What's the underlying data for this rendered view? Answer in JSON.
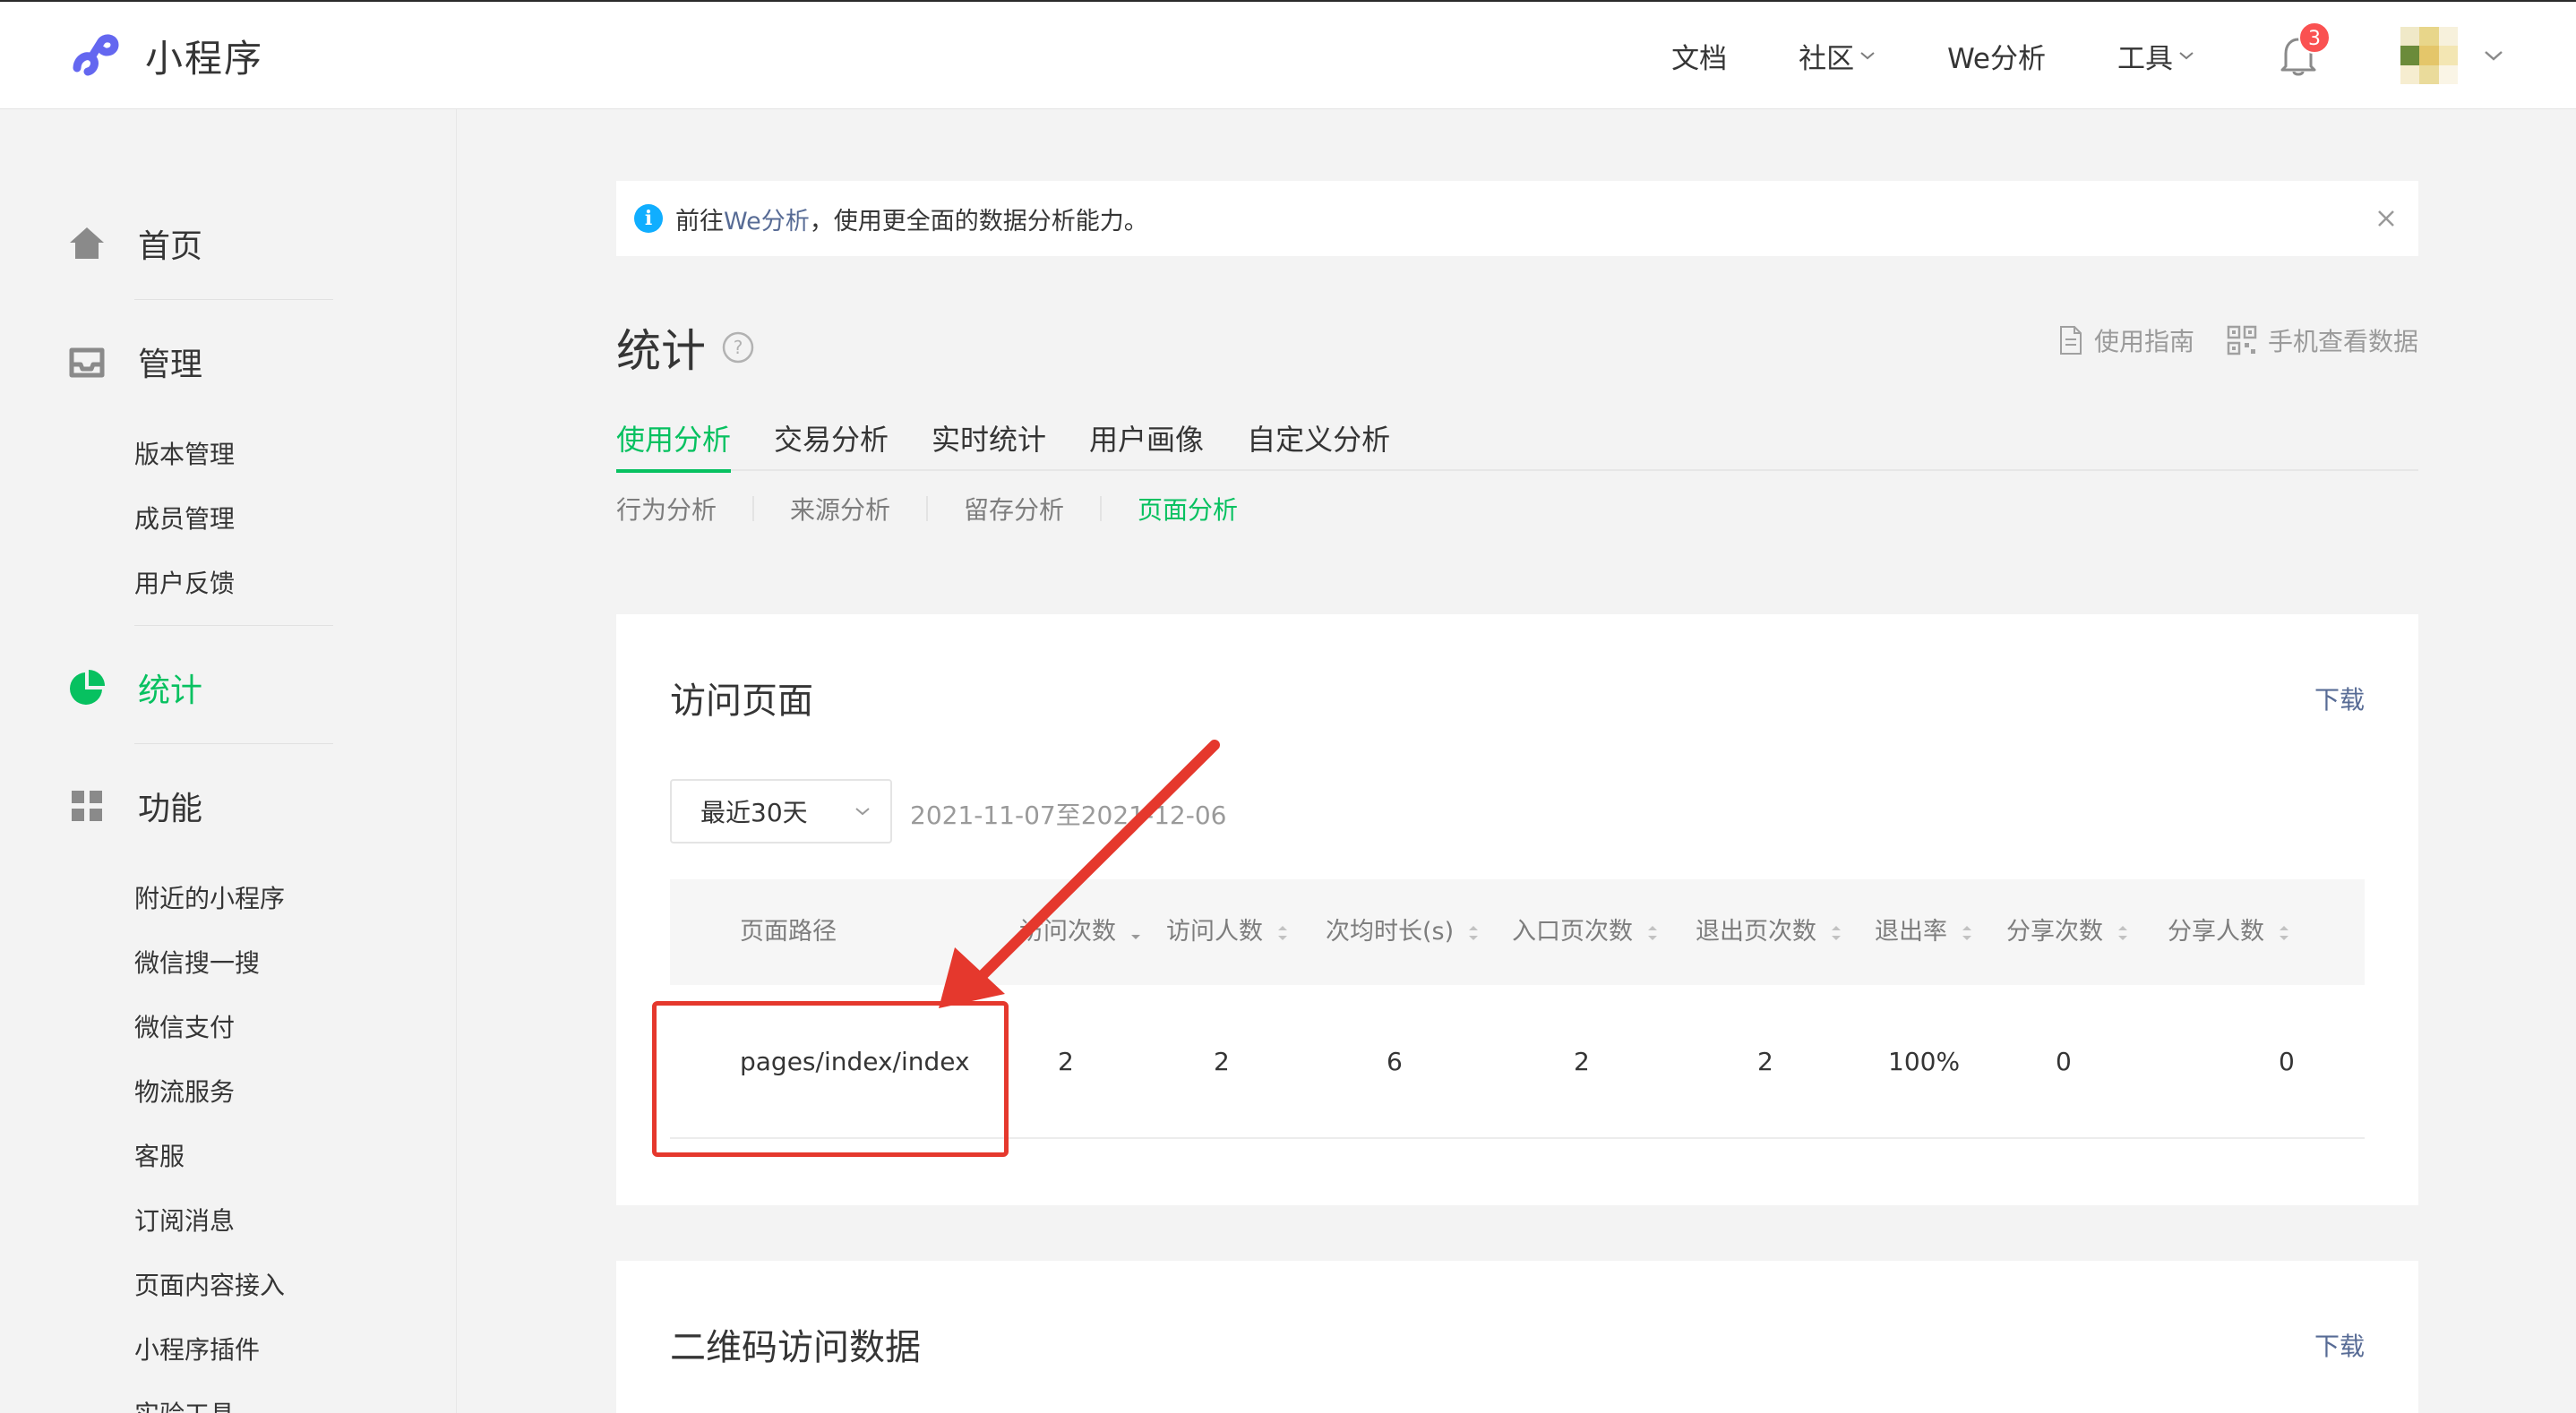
{
  "header": {
    "brand": "小程序",
    "nav": [
      {
        "label": "文档",
        "has_dropdown": false
      },
      {
        "label": "社区",
        "has_dropdown": true
      },
      {
        "label": "We分析",
        "has_dropdown": false
      },
      {
        "label": "工具",
        "has_dropdown": true
      }
    ],
    "notification_count": "3"
  },
  "sidebar": {
    "home": "首页",
    "manage": "管理",
    "manage_items": [
      "版本管理",
      "成员管理",
      "用户反馈"
    ],
    "stats": "统计",
    "features": "功能",
    "feature_items": [
      "附近的小程序",
      "微信搜一搜",
      "微信支付",
      "物流服务",
      "客服",
      "订阅消息",
      "页面内容接入",
      "小程序插件",
      "实验工具"
    ]
  },
  "notice": {
    "prefix": "前往",
    "link": "We分析",
    "suffix": "，使用更全面的数据分析能力。"
  },
  "page": {
    "title": "统计",
    "tools": {
      "guide": "使用指南",
      "mobile": "手机查看数据"
    }
  },
  "tabs": [
    "使用分析",
    "交易分析",
    "实时统计",
    "用户画像",
    "自定义分析"
  ],
  "subtabs": [
    "行为分析",
    "来源分析",
    "留存分析",
    "页面分析"
  ],
  "visit_card": {
    "title": "访问页面",
    "download": "下载",
    "range_select": "最近30天",
    "range_text": "2021-11-07至2021-12-06",
    "columns": [
      "页面路径",
      "访问次数",
      "访问人数",
      "次均时长(s)",
      "入口页次数",
      "退出页次数",
      "退出率",
      "分享次数",
      "分享人数"
    ],
    "rows": [
      [
        "pages/index/index",
        "2",
        "2",
        "6",
        "2",
        "2",
        "100%",
        "0",
        "0"
      ]
    ]
  },
  "qr_card": {
    "title": "二维码访问数据",
    "download": "下载"
  },
  "colors": {
    "accent": "#07c160",
    "link": "#576b95",
    "annotation": "#e5382d",
    "badge": "#fa5151"
  }
}
